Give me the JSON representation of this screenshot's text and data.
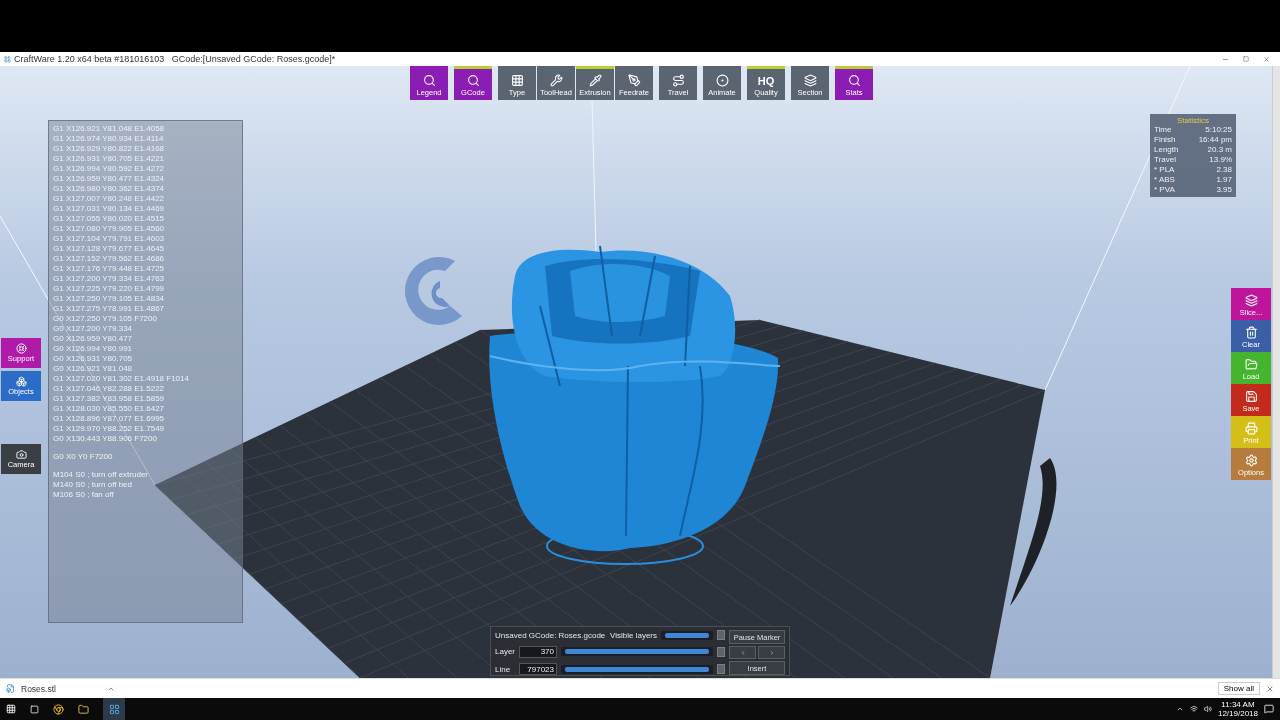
{
  "window": {
    "title": "CraftWare 1.20 x64 beta #181016103   GCode:[Unsaved GCode: Roses.gcode]*"
  },
  "toolbar": {
    "groups": [
      {
        "buttons": [
          {
            "label": "Legend",
            "kind": "purple",
            "active": false
          }
        ]
      },
      {
        "buttons": [
          {
            "label": "GCode",
            "kind": "purple",
            "active": true
          }
        ]
      },
      {
        "buttons": [
          {
            "label": "Type",
            "kind": "grey",
            "active": false
          },
          {
            "label": "ToolHead",
            "kind": "grey",
            "active": false
          },
          {
            "label": "Extrusion",
            "kind": "grey",
            "active": true
          },
          {
            "label": "Feedrate",
            "kind": "grey",
            "active": false
          }
        ]
      },
      {
        "buttons": [
          {
            "label": "Travel",
            "kind": "grey",
            "active": false
          }
        ]
      },
      {
        "buttons": [
          {
            "label": "Animate",
            "kind": "grey",
            "active": false
          }
        ]
      },
      {
        "buttons": [
          {
            "label": "Quality",
            "kind": "grey",
            "active": true,
            "icon_text": "HQ"
          }
        ]
      },
      {
        "buttons": [
          {
            "label": "Section",
            "kind": "grey",
            "active": false
          }
        ]
      },
      {
        "buttons": [
          {
            "label": "Stats",
            "kind": "purple",
            "active": true
          }
        ]
      }
    ]
  },
  "gcode_panel": {
    "lines": [
      "G1 X126.921 Y81.048 E1.4058",
      "G1 X126.974 Y80.934 E1.4114",
      "G1 X126.929 Y80.822 E1.4168",
      "G1 X126.931 Y80.705 E1.4221",
      "G1 X126.994 Y80.592 E1.4272",
      "G1 X126.959 Y80.477 E1.4324",
      "G1 X126.980 Y80.362 E1.4374",
      "G1 X127.007 Y80.248 E1.4422",
      "G1 X127.031 Y80.134 E1.4469",
      "G1 X127.055 Y80.020 E1.4515",
      "G1 X127.080 Y79.905 E1.4560",
      "G1 X127.104 Y79.791 E1.4603",
      "G1 X127.128 Y79.677 E1.4645",
      "G1 X127.152 Y79.562 E1.4686",
      "G1 X127.176 Y79.448 E1.4725",
      "G1 X127.200 Y79.334 E1.4763",
      "G1 X127.225 Y79.220 E1.4799",
      "G1 X127.250 Y79.105 E1.4834",
      "G1 X127.275 Y78.991 E1.4867",
      "G0 X127.250 Y79.105 F7200",
      "G0 X127.200 Y79.334",
      "G0 X126.959 Y80.477",
      "G0 X126.994 Y80.991",
      "G0 X126.931 Y80.705",
      "G0 X126.921 Y81.048",
      "G1 X127.020 Y81.302 E1.4918 F1014",
      "G1 X127.046 Y82.288 E1.5222",
      "G1 X127.382 Y83.958 E1.5859",
      "G1 X128.030 Y85.550 E1.6427",
      "G1 X128.896 Y87.077 E1.6995",
      "G1 X129.970 Y88.252 E1.7549",
      "G0 X130.443 Y88.906 F7200"
    ],
    "footer_lines": [
      "G0 X0 Y0 F7200",
      "M104 S0 ; turn off extruder",
      "M140 S0 ; turn off bed",
      "M106 S0 ; fan off"
    ]
  },
  "stats": {
    "title": "Statistics",
    "rows": [
      {
        "label": "Time",
        "value": "5:10:25"
      },
      {
        "label": "Finish",
        "value": "16:44 pm"
      },
      {
        "label": "Length",
        "value": "20.3 m"
      },
      {
        "label": "Travel",
        "value": "13.9%"
      },
      {
        "label": "* PLA",
        "value": "2.38"
      },
      {
        "label": "* ABS",
        "value": "1.97"
      },
      {
        "label": "* PVA",
        "value": "3.95"
      }
    ]
  },
  "left_buttons": [
    {
      "label": "Support",
      "color": "#b01aa8"
    },
    {
      "label": "Objects",
      "color": "#2a6cc8"
    },
    {
      "label": "Camera",
      "color": "#3a3f46"
    }
  ],
  "side_buttons": [
    {
      "label": "Slice...",
      "color": "#c0159a"
    },
    {
      "label": "Clear",
      "color": "#3b5fa6"
    },
    {
      "label": "Load",
      "color": "#44b52c"
    },
    {
      "label": "Save",
      "color": "#c42a1c"
    },
    {
      "label": "Print",
      "color": "#d4be18"
    },
    {
      "label": "Options",
      "color": "#b67c3e"
    }
  ],
  "layer_panel": {
    "title": "Unsaved GCode: Roses.gcode",
    "visible_label": "Visible layers",
    "visible_slider": {
      "level": 1
    },
    "layer_label": "Layer",
    "layer_value": "370",
    "layer_slider": {
      "level": 1
    },
    "line_label": "Line",
    "line_value": "797023",
    "line_slider": {
      "level": 1
    },
    "pause_button": "Pause Marker",
    "insert_button": "Insert"
  },
  "download_bar": {
    "file": "Roses.stl",
    "show_all": "Show all"
  },
  "taskbar": {
    "time": "11:34 AM",
    "date": "12/19/2018"
  }
}
